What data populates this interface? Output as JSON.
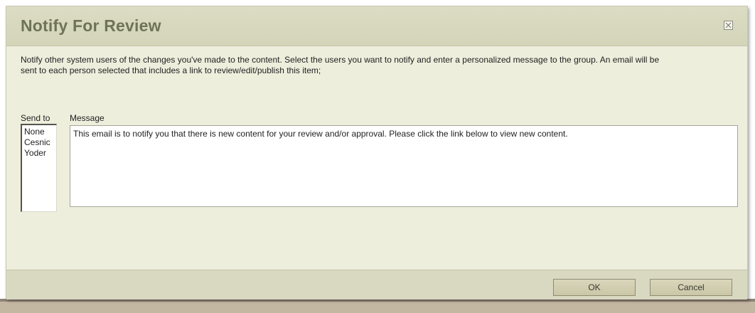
{
  "dialog": {
    "title": "Notify For Review",
    "intro_text": "Notify other system users of the changes you've made to the content. Select the users you want to notify and enter a personalized message to the group. An email will be sent to each person selected that includes a link to review/edit/publish this item;",
    "send_to_label": "Send to",
    "message_label": "Message",
    "send_to_items": [
      "None",
      "Cesnic",
      "Yoder"
    ],
    "message_value": "This email is to notify you that there is new content for your review and/or approval. Please click the link below to view new content.",
    "ok_label": "OK",
    "cancel_label": "Cancel"
  },
  "icons": {
    "close": "close-icon"
  },
  "colors": {
    "dialog_bg": "#eeeedd",
    "titlebar_bg": "#d4d4b9",
    "title_text": "#6e7358",
    "footer_bg": "#d9d9c1",
    "button_bg": "#cbc7a8"
  }
}
